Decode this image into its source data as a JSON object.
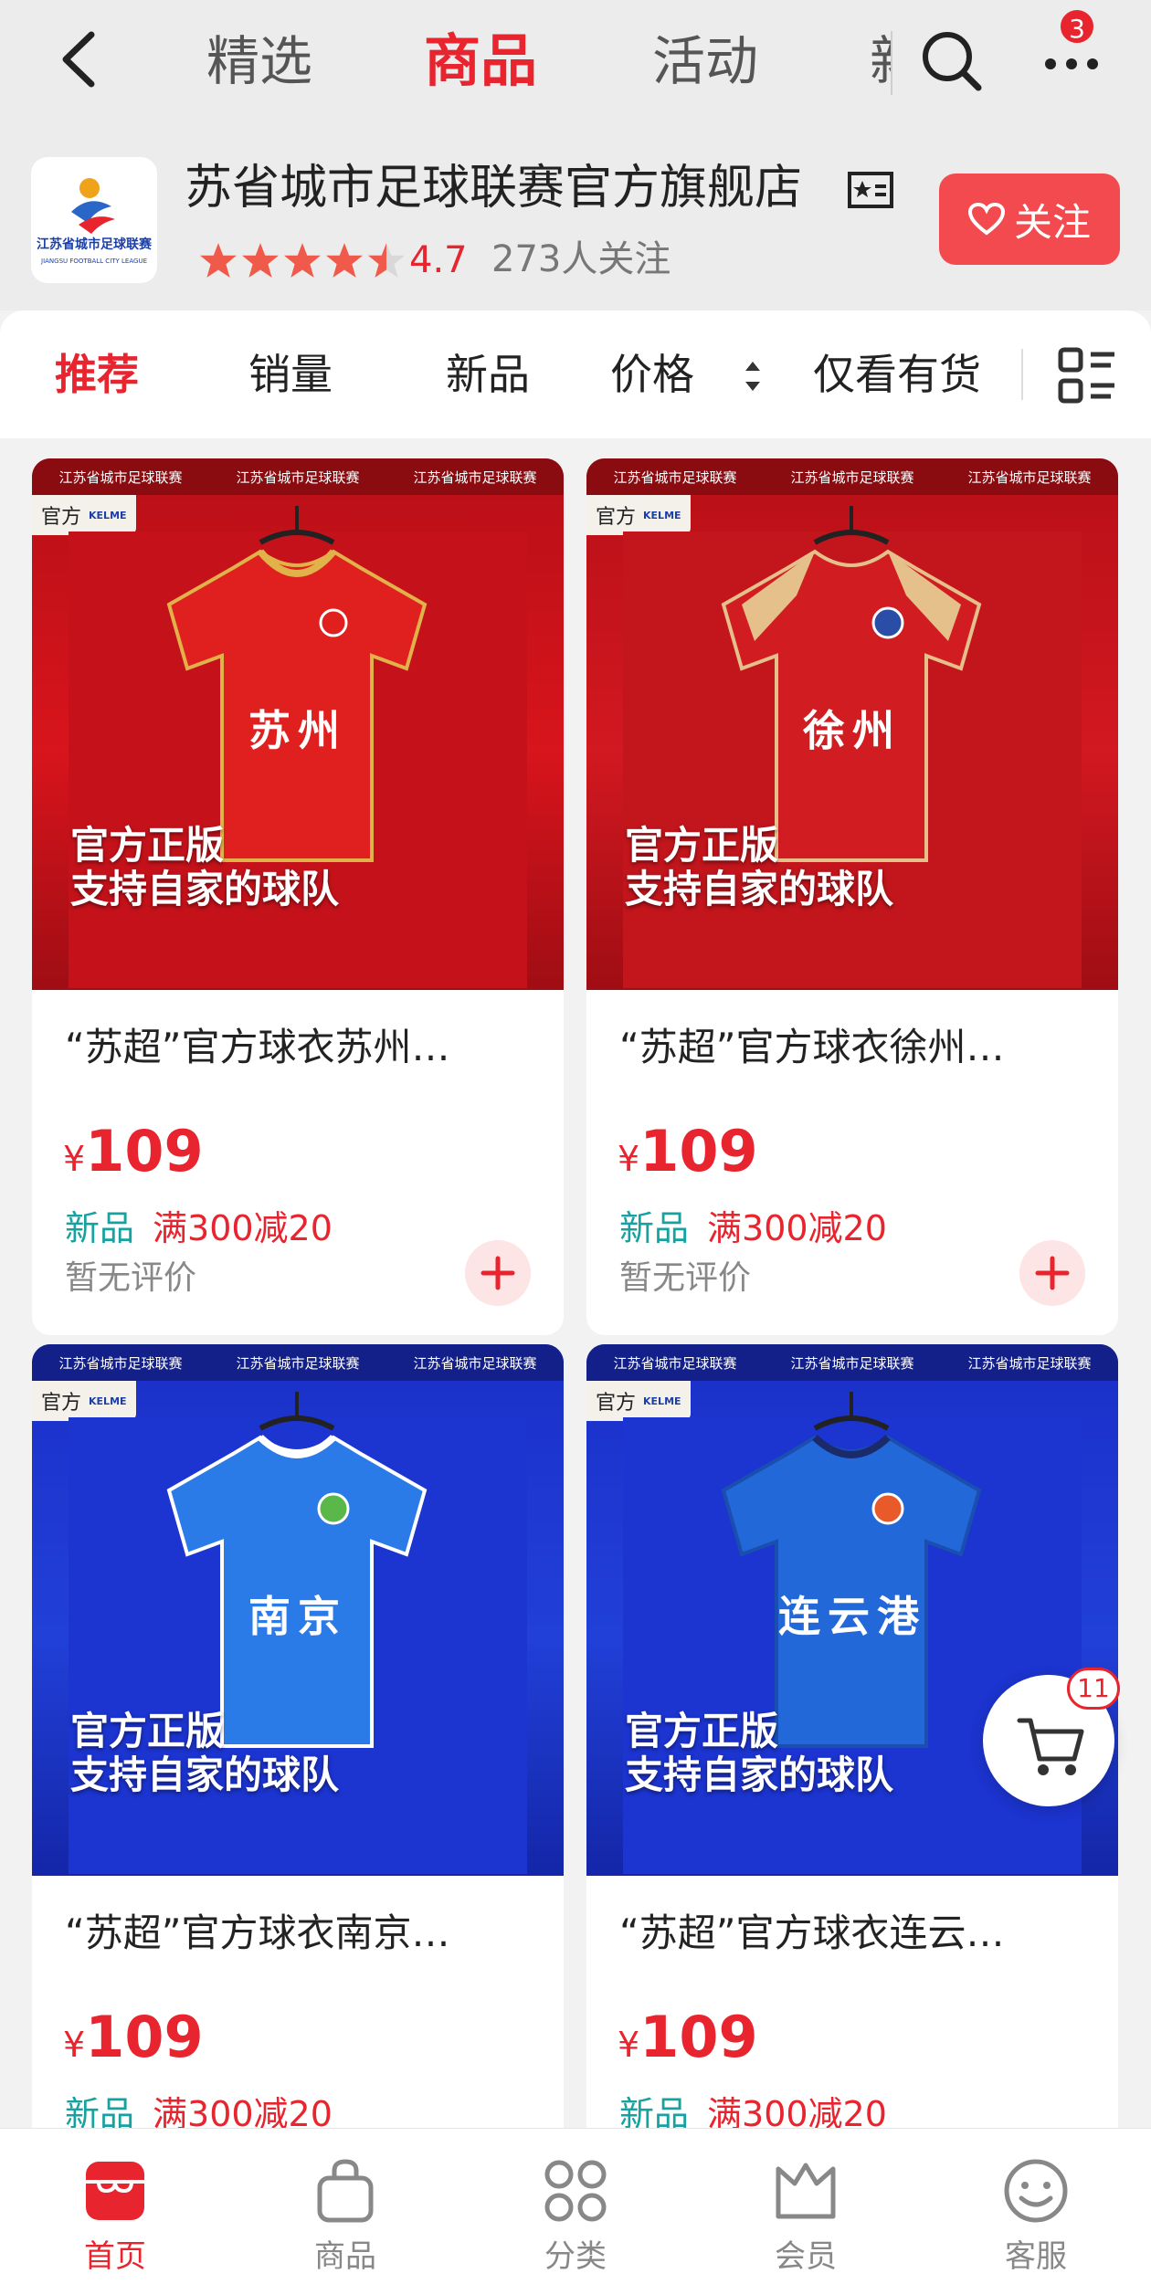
{
  "header": {
    "tabs": [
      {
        "label": "精选"
      },
      {
        "label": "商品"
      },
      {
        "label": "活动"
      },
      {
        "label": "新"
      }
    ],
    "more_badge": "3"
  },
  "store": {
    "name": "苏省城市足球联赛官方旗舰店",
    "rating": "4.7",
    "followers": "273人关注",
    "follow_label": "关注",
    "logo_text": "江苏省城市足球联赛",
    "logo_subtext": "JIANGSU FOOTBALL CITY LEAGUE"
  },
  "sort": {
    "recommend": "推荐",
    "sales": "销量",
    "new": "新品",
    "price": "价格",
    "in_stock": "仅看有货"
  },
  "image_common": {
    "banner": "江苏省城市足球联赛",
    "tag": "官方",
    "brand": "KELME",
    "overlay_line1": "官方正版",
    "overlay_line2": "支持自家的球队"
  },
  "products": [
    {
      "title": "“苏超”官方球衣苏州…",
      "jersey": "苏州",
      "currency": "¥",
      "price": "109",
      "tag_new": "新品",
      "tag_promo": "满300减20",
      "review": "暂无评价",
      "color": "#d8141c"
    },
    {
      "title": "“苏超”官方球衣徐州…",
      "jersey": "徐州",
      "currency": "¥",
      "price": "109",
      "tag_new": "新品",
      "tag_promo": "满300减20",
      "review": "暂无评价",
      "color": "#c8161e"
    },
    {
      "title": "“苏超”官方球衣南京…",
      "jersey": "南京",
      "currency": "¥",
      "price": "109",
      "tag_new": "新品",
      "tag_promo": "满300减20",
      "review": "",
      "color": "#1e63d8"
    },
    {
      "title": "“苏超”官方球衣连云…",
      "jersey": "连云港",
      "currency": "¥",
      "price": "109",
      "tag_new": "新品",
      "tag_promo": "满300减20",
      "review": "",
      "color": "#1f66d0"
    }
  ],
  "cart": {
    "badge": "11"
  },
  "bottom_nav": [
    {
      "label": "首页",
      "icon": "shop-home-icon"
    },
    {
      "label": "商品",
      "icon": "bag-icon"
    },
    {
      "label": "分类",
      "icon": "category-icon"
    },
    {
      "label": "会员",
      "icon": "crown-icon"
    },
    {
      "label": "客服",
      "icon": "service-icon"
    }
  ],
  "colors": {
    "accent": "#e8242e",
    "teal": "#17a2a0",
    "bg": "#f2f2f2"
  }
}
